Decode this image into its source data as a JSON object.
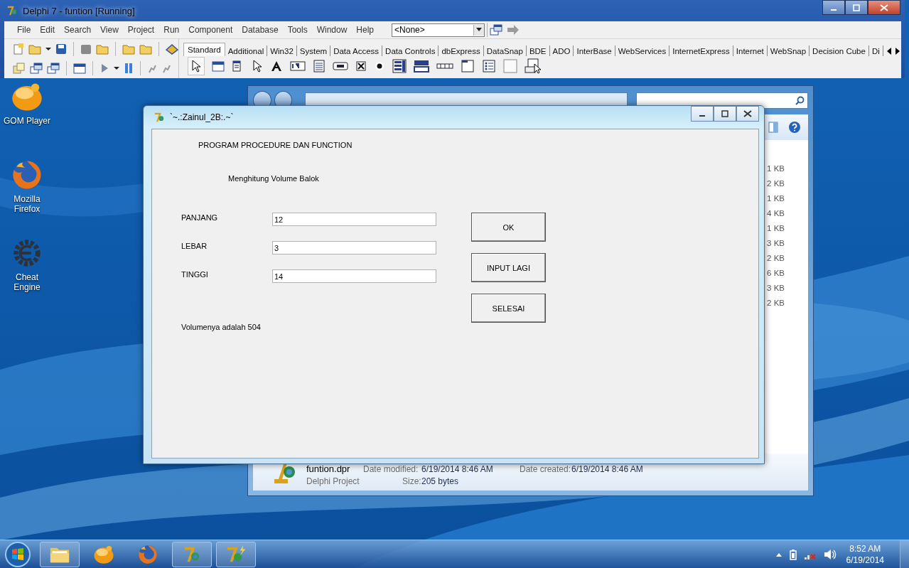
{
  "desktop_icons": [
    {
      "kind": "gom",
      "label": "GOM Player"
    },
    {
      "kind": "firefox",
      "label": "Mozilla Firefox"
    },
    {
      "kind": "cheat",
      "label": "Cheat Engine"
    }
  ],
  "ide": {
    "title": "Delphi 7 - funtion [Running]",
    "menu": [
      "File",
      "Edit",
      "Search",
      "View",
      "Project",
      "Run",
      "Component",
      "Database",
      "Tools",
      "Window",
      "Help"
    ],
    "combo": {
      "value": "<None>"
    },
    "palette_tabs": [
      {
        "label": "Standard",
        "selected": true
      },
      {
        "label": "Additional",
        "selected": false
      },
      {
        "label": "Win32",
        "selected": false
      },
      {
        "label": "System",
        "selected": false
      },
      {
        "label": "Data Access",
        "selected": false
      },
      {
        "label": "Data Controls",
        "selected": false
      },
      {
        "label": "dbExpress",
        "selected": false
      },
      {
        "label": "DataSnap",
        "selected": false
      },
      {
        "label": "BDE",
        "selected": false
      },
      {
        "label": "ADO",
        "selected": false
      },
      {
        "label": "InterBase",
        "selected": false
      },
      {
        "label": "WebServices",
        "selected": false
      },
      {
        "label": "InternetExpress",
        "selected": false
      },
      {
        "label": "Internet",
        "selected": false
      },
      {
        "label": "WebSnap",
        "selected": false
      },
      {
        "label": "Decision Cube",
        "selected": false
      },
      {
        "label": "Di",
        "selected": false
      }
    ]
  },
  "explorer": {
    "sizes": [
      "1 KB",
      "2 KB",
      "1 KB",
      "4 KB",
      "1 KB",
      "3 KB",
      "2 KB",
      "6 KB",
      "3 KB",
      "2 KB"
    ],
    "details": {
      "name": "funtion.dpr",
      "modified_label": "Date modified:",
      "modified": "6/19/2014 8:46 AM",
      "created_label": "Date created:",
      "created": "6/19/2014 8:46 AM",
      "type": "Delphi Project",
      "size_label": "Size:",
      "size": "205 bytes"
    }
  },
  "form": {
    "title": "`~.:Zainul_2B:.~`",
    "heading": "PROGRAM PROCEDURE DAN FUNCTION",
    "subheading": "Menghitung Volume Balok",
    "fields": [
      {
        "label": "PANJANG",
        "value": "12"
      },
      {
        "label": "LEBAR",
        "value": "3"
      },
      {
        "label": "TINGGI",
        "value": "14"
      }
    ],
    "result": "Volumenya adalah 504",
    "buttons": [
      "OK",
      "INPUT LAGI",
      "SELESAI"
    ]
  },
  "taskbar": {
    "items": [
      {
        "kind": "explorer",
        "open": true
      },
      {
        "kind": "gom",
        "open": false
      },
      {
        "kind": "firefox",
        "open": false
      },
      {
        "kind": "delphi",
        "open": true
      },
      {
        "kind": "delphi-run",
        "open": true
      }
    ],
    "time": "8:52 AM",
    "date": "6/19/2014"
  }
}
